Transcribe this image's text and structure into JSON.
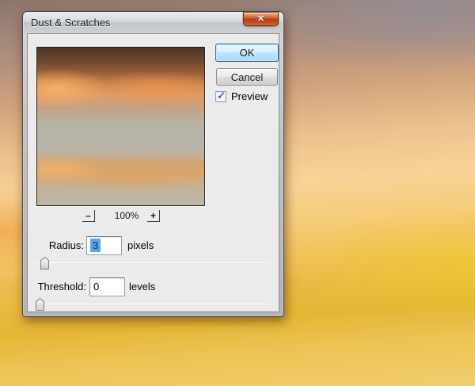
{
  "window": {
    "title": "Dust & Scratches",
    "close_glyph": "✕"
  },
  "buttons": {
    "ok": "OK",
    "cancel": "Cancel"
  },
  "preview_checkbox": {
    "label": "Preview",
    "checked": true,
    "glyph": "✓"
  },
  "zoom": {
    "out_label": "–",
    "level": "100%",
    "in_label": "+"
  },
  "fields": {
    "radius": {
      "label": "Radius:",
      "value": "3",
      "unit": "pixels"
    },
    "threshold": {
      "label": "Threshold:",
      "value": "0",
      "unit": "levels"
    }
  },
  "colors": {
    "dialog_background": "#ebebeb",
    "close_button_red": "#c24d22",
    "ok_focus_blue": "#a7d9f5",
    "selection_highlight": "#58a6de",
    "checkbox_check_blue": "#31629c"
  }
}
